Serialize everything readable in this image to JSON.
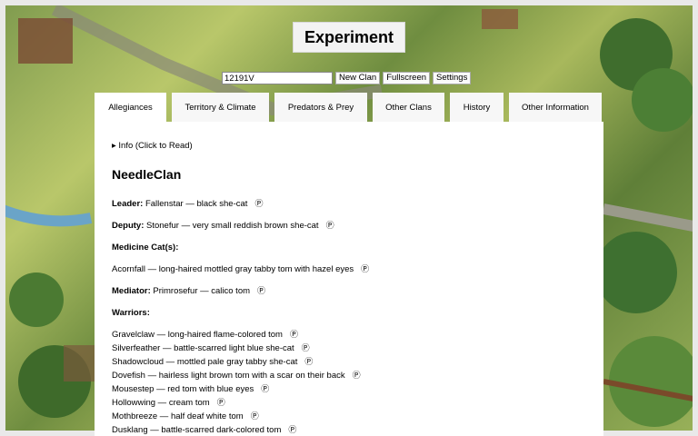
{
  "header": {
    "title": "Experiment"
  },
  "controls": {
    "seed_value": "12191V",
    "new_clan_label": "New Clan",
    "fullscreen_label": "Fullscreen",
    "settings_label": "Settings"
  },
  "tabs": [
    {
      "label": "Allegiances",
      "active": true
    },
    {
      "label": "Territory & Climate"
    },
    {
      "label": "Predators & Prey"
    },
    {
      "label": "Other Clans"
    },
    {
      "label": "History"
    },
    {
      "label": "Other Information"
    }
  ],
  "panel": {
    "info_label": "▸ Info (Click to Read)",
    "clan_name": "NeedleClan",
    "leader_label": "Leader:",
    "leader_value": " Fallenstar — black she-cat",
    "deputy_label": "Deputy:",
    "deputy_value": " Stonefur — very small reddish brown she-cat",
    "medicine_label": "Medicine Cat(s):",
    "medicine_cat": "Acornfall — long-haired mottled gray tabby tom with hazel eyes",
    "mediator_label": "Mediator:",
    "mediator_value": " Primrosefur — calico tom",
    "warriors_label": "Warriors:",
    "warriors": [
      "Gravelclaw — long-haired flame-colored tom",
      "Silverfeather — battle-scarred light blue she-cat",
      "Shadowcloud — mottled pale gray tabby she-cat",
      "Dovefish — hairless light brown tom with a scar on their back",
      "Mousestep — red tom with blue eyes",
      "Hollowwing — cream tom",
      "Mothbreeze — half deaf white tom",
      "Dusklang — battle-scarred dark-colored tom"
    ]
  },
  "icons": {
    "help": "help-icon"
  }
}
